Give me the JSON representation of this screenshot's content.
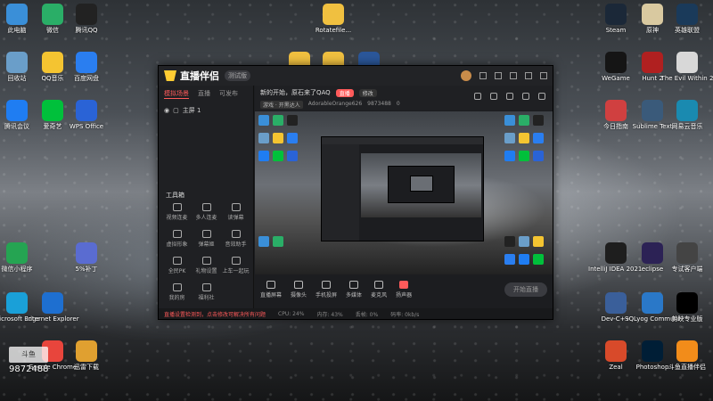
{
  "desktop_left_icons": [
    {
      "label": "此电脑",
      "icon": "computer-icon",
      "color": "#3a8fd8"
    },
    {
      "label": "微信",
      "icon": "wechat-icon",
      "color": "#2aae67"
    },
    {
      "label": "腾讯QQ",
      "icon": "qq-icon",
      "color": "#222222"
    },
    {
      "label": "回收站",
      "icon": "recycle-bin-icon",
      "color": "#6a9ec9"
    },
    {
      "label": "QQ音乐",
      "icon": "qq-music-icon",
      "color": "#f4c431"
    },
    {
      "label": "百度网盘",
      "icon": "baidu-netdisk-icon",
      "color": "#2a7ef0"
    },
    {
      "label": "腾讯会议",
      "icon": "tencent-meeting-icon",
      "color": "#1f7df2"
    },
    {
      "label": "爱奇艺",
      "icon": "iqiyi-icon",
      "color": "#00c03b"
    },
    {
      "label": "WPS Office",
      "icon": "wps-icon",
      "color": "#2a63d6"
    },
    {
      "label": "微信小程序",
      "icon": "mini-program-icon",
      "color": "#25a452"
    },
    {
      "label": "5%补丁",
      "icon": "patch-icon",
      "color": "#5a6cd1"
    },
    {
      "label": "Microsoft Edge",
      "icon": "edge-icon",
      "color": "#1aa0d8"
    },
    {
      "label": "Internet Explorer",
      "icon": "ie-icon",
      "color": "#1e6fd0"
    },
    {
      "label": "Google Chrome",
      "icon": "chrome-icon",
      "color": "#e8453c"
    },
    {
      "label": "迅雷下载",
      "icon": "thunder-icon",
      "color": "#e0a030"
    }
  ],
  "desktop_top_icons": [
    {
      "label": "Rotatefile...",
      "icon": "folder-icon",
      "color": "#f0c040"
    },
    {
      "label": "",
      "icon": "folder-icon",
      "color": "#f0c040"
    },
    {
      "label": "",
      "icon": "folder-icon",
      "color": "#f0c040"
    },
    {
      "label": "W",
      "icon": "word-icon",
      "color": "#2b579a"
    }
  ],
  "desktop_right_icons": [
    {
      "label": "Steam",
      "icon": "steam-icon",
      "color": "#1b2838"
    },
    {
      "label": "原神",
      "icon": "genshin-icon",
      "color": "#d9c9a0"
    },
    {
      "label": "英雄联盟",
      "icon": "lol-icon",
      "color": "#1a3a5a"
    },
    {
      "label": "WeGame",
      "icon": "wegame-icon",
      "color": "#151515"
    },
    {
      "label": "Hunt 2",
      "icon": "hunt-icon",
      "color": "#b02020"
    },
    {
      "label": "The Evil Within 2",
      "icon": "evil-within-icon",
      "color": "#d8d8d8"
    },
    {
      "label": "今日指南",
      "icon": "guide-icon",
      "color": "#d04040"
    },
    {
      "label": "Sublime Text",
      "icon": "sublime-icon",
      "color": "#3a5a7a"
    },
    {
      "label": "网易云音乐",
      "icon": "netease-music-icon",
      "color": "#1a8ab0"
    },
    {
      "label": "IntelliJ IDEA 2021.2",
      "icon": "intellij-icon",
      "color": "#1e1e1e"
    },
    {
      "label": "eclipse",
      "icon": "eclipse-icon",
      "color": "#2c2255"
    },
    {
      "label": "专试客户端",
      "icon": "client-icon",
      "color": "#444444"
    },
    {
      "label": "Dev-C++",
      "icon": "devcpp-icon",
      "color": "#3a5f9a"
    },
    {
      "label": "SQLyog Communi...",
      "icon": "sqlyog-icon",
      "color": "#2a78c8"
    },
    {
      "label": "剪映专业版",
      "icon": "capcut-icon",
      "color": "#000000"
    },
    {
      "label": "Zeal",
      "icon": "zeal-icon",
      "color": "#d84a2a"
    },
    {
      "label": "Photoshop",
      "icon": "photoshop-icon",
      "color": "#001e36"
    },
    {
      "label": "斗鱼直播伴侣",
      "icon": "douyu-icon",
      "color": "#f28c1a"
    }
  ],
  "app": {
    "name": "直播伴侣",
    "badge": "测试版",
    "tabs": [
      "模拟场景",
      "直播",
      "可发布"
    ],
    "active_tab_index": 0,
    "scene_label": "主屏 1",
    "tools_title": "工具箱",
    "tools": [
      "视频连麦",
      "多人连麦",
      "读弹幕",
      "虚拟形象",
      "弹幕姬",
      "音效助手",
      "全民PK",
      "礼物设置",
      "上车一起玩",
      "我的房",
      "福利社"
    ],
    "header": {
      "title": "新的开始，原石来了QAQ",
      "pill": "直播",
      "pill2": "修改",
      "tag": "游戏 · 开黑达人",
      "user": "AdorableOrange626",
      "room": "9873488",
      "count": "0"
    },
    "controls": [
      "直播屏幕",
      "摄像头",
      "手机投屏",
      "多媒体",
      "麦克风",
      "扬声器"
    ],
    "live_button": "开始直播",
    "status": {
      "warning": "直播设置检测到，点击修改可解决所有问题",
      "items": [
        "CPU: 24%",
        "内存: 43%",
        "丢帧: 0%",
        "码率: 0kb/s"
      ]
    }
  },
  "watermark": {
    "logo": "斗鱼",
    "number": "9872488"
  }
}
